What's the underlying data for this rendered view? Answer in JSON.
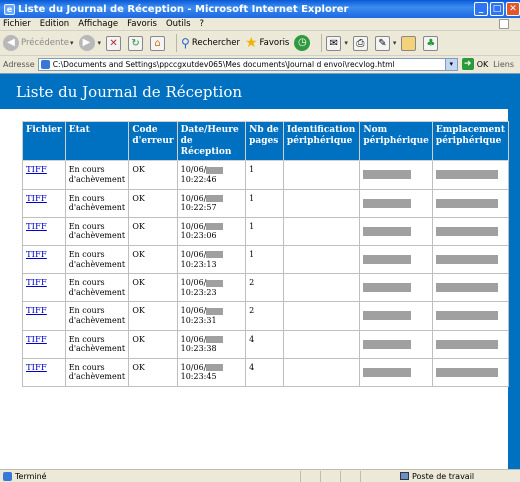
{
  "window": {
    "title": "Liste du Journal de Réception - Microsoft Internet Explorer",
    "controls": {
      "minimize": "_",
      "maximize": "□",
      "close": "✕"
    }
  },
  "menu": [
    "Fichier",
    "Edition",
    "Affichage",
    "Favoris",
    "Outils",
    "?"
  ],
  "toolbar": {
    "back_label": "Précédente",
    "search_label": "Rechercher",
    "favorites_label": "Favoris"
  },
  "address": {
    "label": "Adresse",
    "value": "C:\\Documents and Settings\\ppccgxutdev065\\Mes documents\\Journal d envoi\\recvlog.html",
    "go_label": "OK",
    "links_label": "Liens"
  },
  "page": {
    "heading": "Liste du Journal de Réception"
  },
  "table": {
    "headers": [
      "Fichier",
      "Etat",
      "Code d'erreur",
      "Date/Heure de Réception",
      "Nb de pages",
      "Identification périphérique",
      "Nom périphérique",
      "Emplacement périphérique"
    ],
    "rows": [
      {
        "file": "TIFF",
        "state": "En cours d'achèvement",
        "code": "OK",
        "date": "10/06/",
        "time": "10:22:46",
        "pages": "1"
      },
      {
        "file": "TIFF",
        "state": "En cours d'achèvement",
        "code": "OK",
        "date": "10/06/",
        "time": "10:22:57",
        "pages": "1"
      },
      {
        "file": "TIFF",
        "state": "En cours d'achèvement",
        "code": "OK",
        "date": "10/06/",
        "time": "10:23:06",
        "pages": "1"
      },
      {
        "file": "TIFF",
        "state": "En cours d'achèvement",
        "code": "OK",
        "date": "10/06/",
        "time": "10:23:13",
        "pages": "1"
      },
      {
        "file": "TIFF",
        "state": "En cours d'achèvement",
        "code": "OK",
        "date": "10/06/",
        "time": "10:23:23",
        "pages": "2"
      },
      {
        "file": "TIFF",
        "state": "En cours d'achèvement",
        "code": "OK",
        "date": "10/06/",
        "time": "10:23:31",
        "pages": "2"
      },
      {
        "file": "TIFF",
        "state": "En cours d'achèvement",
        "code": "OK",
        "date": "10/06/",
        "time": "10:23:38",
        "pages": "4"
      },
      {
        "file": "TIFF",
        "state": "En cours d'achèvement",
        "code": "OK",
        "date": "10/06/",
        "time": "10:23:45",
        "pages": "4"
      }
    ]
  },
  "status": {
    "left": "Terminé",
    "zone": "Poste de travail"
  }
}
